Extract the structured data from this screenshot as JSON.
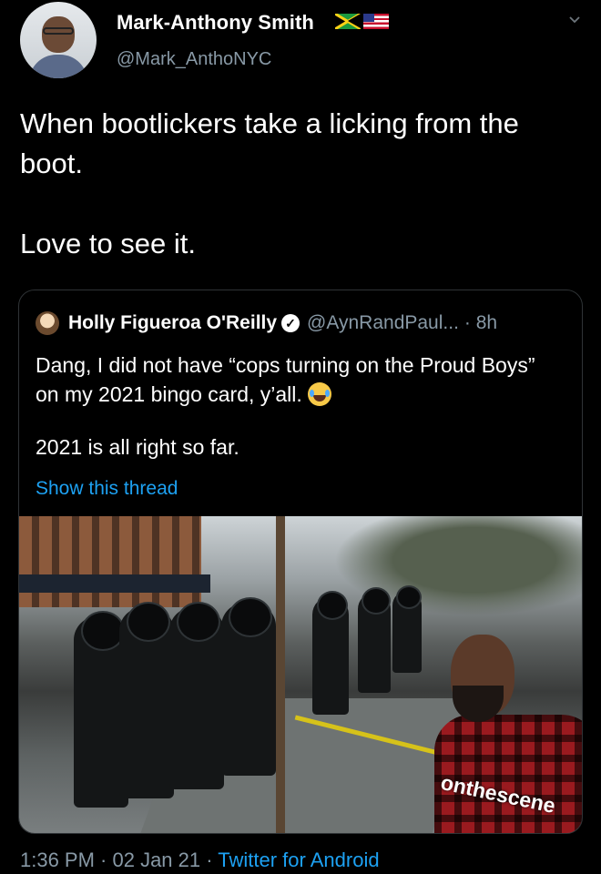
{
  "tweet": {
    "author_name": "Mark-Anthony Smith",
    "author_handle": "@Mark_AnthoNYC",
    "text_line1": "When bootlickers take a licking from the boot.",
    "text_line2": "Love to see it."
  },
  "quoted_tweet": {
    "author_name": "Holly Figueroa O'Reilly",
    "author_handle": "@AynRandPaul...",
    "time": "· 8h",
    "text_line1": "Dang, I did not have “cops turning on the Proud Boys” on my 2021 bingo card, y’all.",
    "text_line2": "2021 is all right so far.",
    "show_thread": "Show this thread",
    "media_watermark": "onthescene"
  },
  "footer": {
    "time": "1:36 PM · 02 Jan 21 · ",
    "source": "Twitter for Android"
  },
  "icons": [
    "jamaica-flag-icon",
    "us-flag-icon",
    "chevron-down-icon",
    "verified-badge-icon",
    "tears-of-joy-emoji-icon"
  ],
  "colors": {
    "background": "#000000",
    "secondary_text": "#8899a6",
    "link": "#1da1f2"
  }
}
